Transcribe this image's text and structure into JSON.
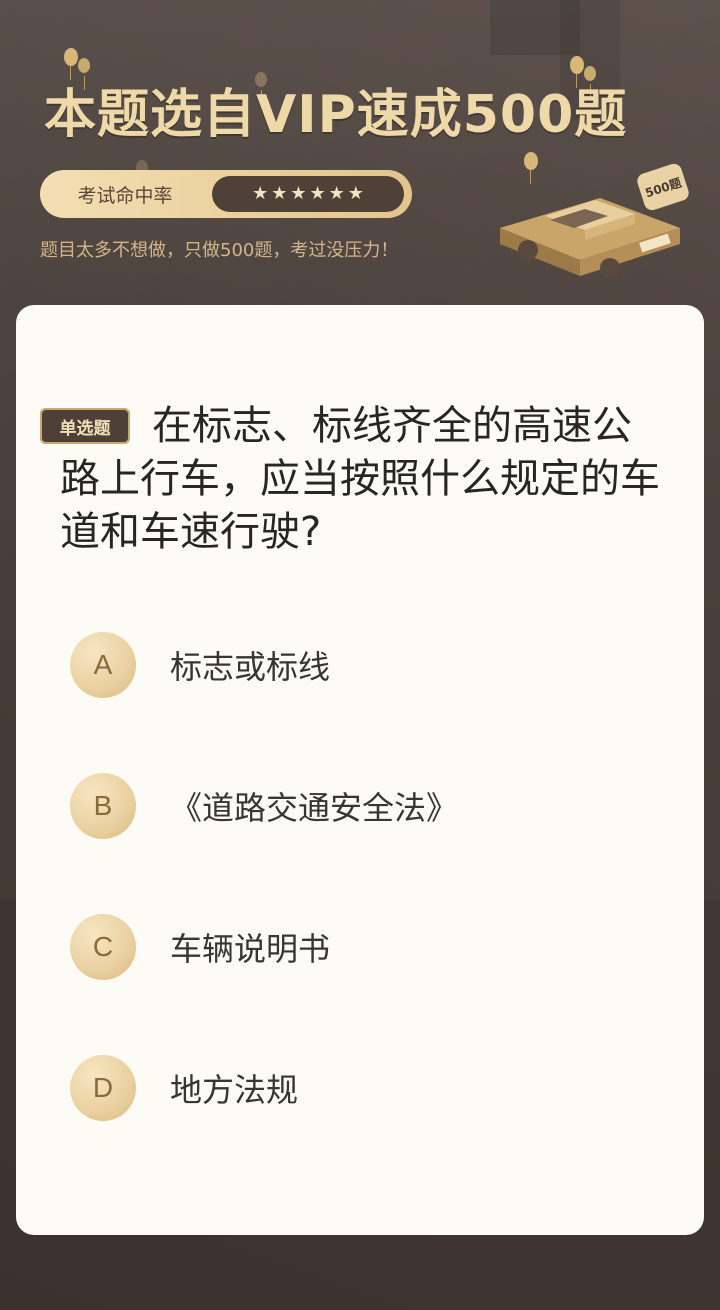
{
  "header": {
    "title": "本题选自VIP速成500题",
    "rate_label": "考试命中率",
    "stars": [
      "★",
      "★",
      "★",
      "★",
      "★",
      "★"
    ],
    "subtitle": "题目太多不想做，只做500题，考过没压力！",
    "badge": "500题"
  },
  "question": {
    "tag": "单选题",
    "text": "在标志、标线齐全的高速公路上行车，应当按照什么规定的车道和车速行驶?",
    "options": [
      {
        "letter": "A",
        "text": "标志或标线"
      },
      {
        "letter": "B",
        "text": "《道路交通安全法》"
      },
      {
        "letter": "C",
        "text": "车辆说明书"
      },
      {
        "letter": "D",
        "text": "地方法规"
      }
    ]
  },
  "colors": {
    "background": "#4a403b",
    "gold": "#f0d9a8",
    "card": "#fcfbf6",
    "tag_bg": "#4e4036"
  }
}
